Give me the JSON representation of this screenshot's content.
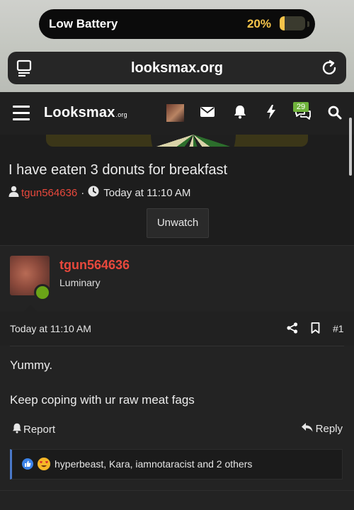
{
  "status_bar": {
    "battery_label": "Low Battery",
    "battery_percent_text": "20%",
    "battery_level": 0.2,
    "battery_color": "#f6c44a"
  },
  "browser": {
    "url": "looksmax.org"
  },
  "site": {
    "logo_text": "Looksmax",
    "logo_suffix": ".org",
    "alerts_badge": "29",
    "accent_color": "#e8483c"
  },
  "thread": {
    "title": "I have eaten 3 donuts for breakfast",
    "author": "tgun564636",
    "separator": "·",
    "date": "Today at 11:10 AM",
    "unwatch_label": "Unwatch"
  },
  "post": {
    "username": "tgun564636",
    "user_title": "Luminary",
    "date": "Today at 11:10 AM",
    "number": "#1",
    "body_line1": "Yummy.",
    "body_line2": "Keep coping with ur raw meat fags",
    "report_label": "Report",
    "reply_label": "Reply",
    "reactions_text": "hyperbeast, Kara, iamnotaracist and 2 others"
  }
}
